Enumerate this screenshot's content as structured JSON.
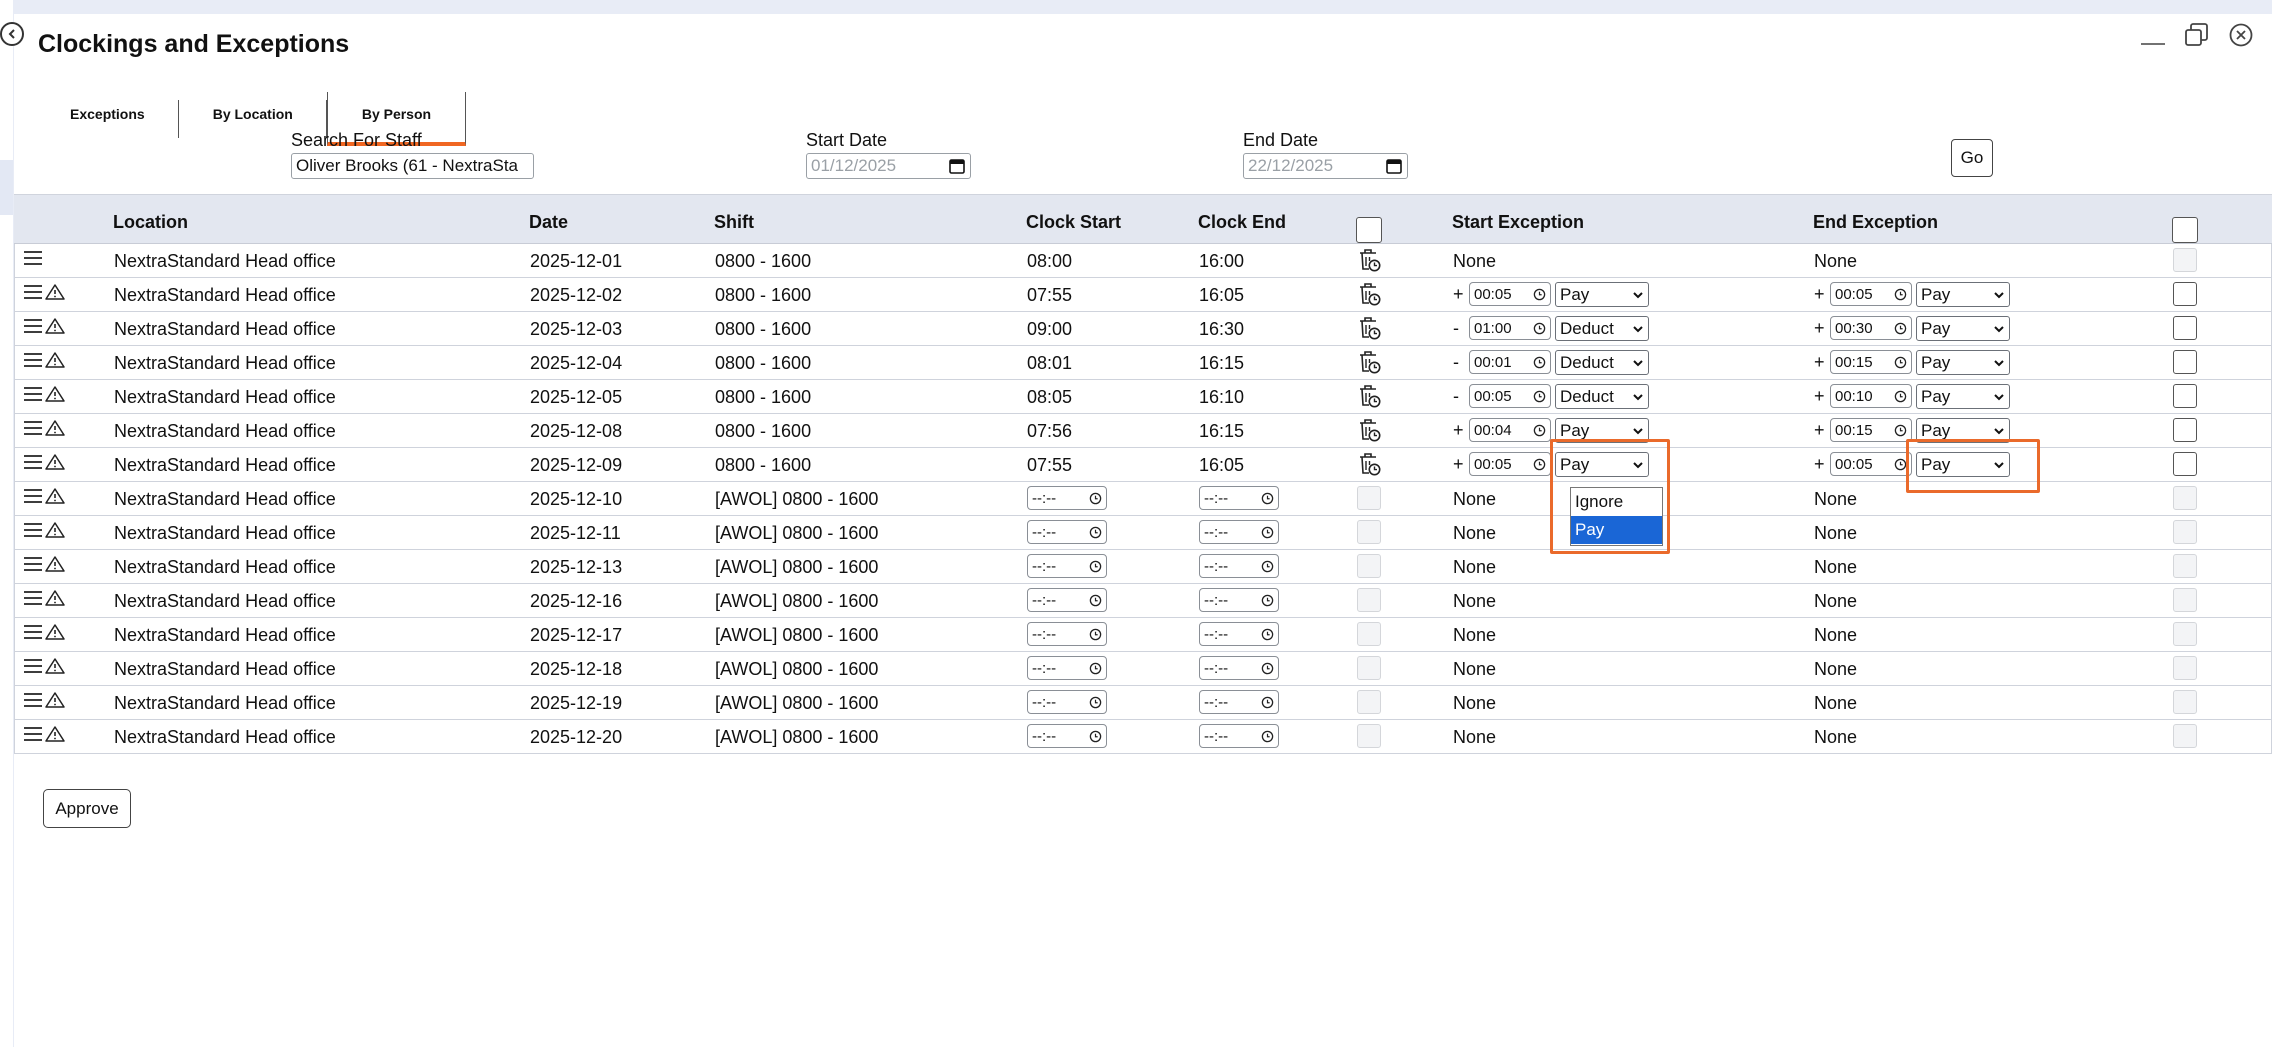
{
  "window": {
    "title": "Clockings and Exceptions"
  },
  "tabs": [
    {
      "label": "Exceptions",
      "active": false
    },
    {
      "label": "By Location",
      "active": false
    },
    {
      "label": "By Person",
      "active": true
    }
  ],
  "filters": {
    "search_label": "Search For Staff",
    "search_value": "Oliver Brooks (61 - NextraSta",
    "start_label": "Start Date",
    "start_value": "01/12/2025",
    "end_label": "End Date",
    "end_value": "22/12/2025",
    "go_label": "Go"
  },
  "columns": {
    "location": "Location",
    "date": "Date",
    "shift": "Shift",
    "clock_start": "Clock Start",
    "clock_end": "Clock End",
    "start_exception": "Start Exception",
    "end_exception": "End Exception"
  },
  "time_placeholder": "--:--",
  "rows": [
    {
      "warn": false,
      "location": "NextraStandard Head office",
      "date": "2025-12-01",
      "shift": "0800 - 1600",
      "clock_start": "08:00",
      "clock_end": "16:00",
      "start_exc": {
        "text": "None"
      },
      "end_exc": {
        "text": "None"
      }
    },
    {
      "warn": true,
      "location": "NextraStandard Head office",
      "date": "2025-12-02",
      "shift": "0800 - 1600",
      "clock_start": "07:55",
      "clock_end": "16:05",
      "start_exc": {
        "sign": "+",
        "time": "00:05",
        "action": "Pay"
      },
      "end_exc": {
        "sign": "+",
        "time": "00:05",
        "action": "Pay"
      }
    },
    {
      "warn": true,
      "location": "NextraStandard Head office",
      "date": "2025-12-03",
      "shift": "0800 - 1600",
      "clock_start": "09:00",
      "clock_end": "16:30",
      "start_exc": {
        "sign": "-",
        "time": "01:00",
        "action": "Deduct"
      },
      "end_exc": {
        "sign": "+",
        "time": "00:30",
        "action": "Pay"
      }
    },
    {
      "warn": true,
      "location": "NextraStandard Head office",
      "date": "2025-12-04",
      "shift": "0800 - 1600",
      "clock_start": "08:01",
      "clock_end": "16:15",
      "start_exc": {
        "sign": "-",
        "time": "00:01",
        "action": "Deduct"
      },
      "end_exc": {
        "sign": "+",
        "time": "00:15",
        "action": "Pay"
      }
    },
    {
      "warn": true,
      "location": "NextraStandard Head office",
      "date": "2025-12-05",
      "shift": "0800 - 1600",
      "clock_start": "08:05",
      "clock_end": "16:10",
      "start_exc": {
        "sign": "-",
        "time": "00:05",
        "action": "Deduct"
      },
      "end_exc": {
        "sign": "+",
        "time": "00:10",
        "action": "Pay"
      }
    },
    {
      "warn": true,
      "location": "NextraStandard Head office",
      "date": "2025-12-08",
      "shift": "0800 - 1600",
      "clock_start": "07:56",
      "clock_end": "16:15",
      "start_exc": {
        "sign": "+",
        "time": "00:04",
        "action": "Pay"
      },
      "end_exc": {
        "sign": "+",
        "time": "00:15",
        "action": "Pay"
      }
    },
    {
      "warn": true,
      "location": "NextraStandard Head office",
      "date": "2025-12-09",
      "shift": "0800 - 1600",
      "clock_start": "07:55",
      "clock_end": "16:05",
      "start_exc": {
        "sign": "+",
        "time": "00:05",
        "action": "Pay"
      },
      "end_exc": {
        "sign": "+",
        "time": "00:05",
        "action": "Pay"
      }
    },
    {
      "warn": true,
      "location": "NextraStandard Head office",
      "date": "2025-12-10",
      "shift": "[AWOL] 0800 - 1600",
      "awol": true,
      "start_exc": {
        "text": "None"
      },
      "end_exc": {
        "text": "None"
      }
    },
    {
      "warn": true,
      "location": "NextraStandard Head office",
      "date": "2025-12-11",
      "shift": "[AWOL] 0800 - 1600",
      "awol": true,
      "start_exc": {
        "text": "None"
      },
      "end_exc": {
        "text": "None"
      }
    },
    {
      "warn": true,
      "location": "NextraStandard Head office",
      "date": "2025-12-13",
      "shift": "[AWOL] 0800 - 1600",
      "awol": true,
      "start_exc": {
        "text": "None"
      },
      "end_exc": {
        "text": "None"
      }
    },
    {
      "warn": true,
      "location": "NextraStandard Head office",
      "date": "2025-12-16",
      "shift": "[AWOL] 0800 - 1600",
      "awol": true,
      "start_exc": {
        "text": "None"
      },
      "end_exc": {
        "text": "None"
      }
    },
    {
      "warn": true,
      "location": "NextraStandard Head office",
      "date": "2025-12-17",
      "shift": "[AWOL] 0800 - 1600",
      "awol": true,
      "start_exc": {
        "text": "None"
      },
      "end_exc": {
        "text": "None"
      }
    },
    {
      "warn": true,
      "location": "NextraStandard Head office",
      "date": "2025-12-18",
      "shift": "[AWOL] 0800 - 1600",
      "awol": true,
      "start_exc": {
        "text": "None"
      },
      "end_exc": {
        "text": "None"
      }
    },
    {
      "warn": true,
      "location": "NextraStandard Head office",
      "date": "2025-12-19",
      "shift": "[AWOL] 0800 - 1600",
      "awol": true,
      "start_exc": {
        "text": "None"
      },
      "end_exc": {
        "text": "None"
      }
    },
    {
      "warn": true,
      "location": "NextraStandard Head office",
      "date": "2025-12-20",
      "shift": "[AWOL] 0800 - 1600",
      "awol": true,
      "start_exc": {
        "text": "None"
      },
      "end_exc": {
        "text": "None"
      }
    }
  ],
  "dropdown": {
    "options": [
      "Ignore",
      "Pay"
    ],
    "selected": "Pay"
  },
  "approve_label": "Approve",
  "colors": {
    "accent": "#f06722",
    "highlight": "#ea6a2b",
    "selected_option": "#1a66d6",
    "header_bg": "#e3e7f0"
  },
  "icons": {
    "row_menu": "hamburger-menu-icon",
    "row_warning": "warning-triangle-icon",
    "row_delete": "trash-clock-icon",
    "time": "clock-icon",
    "dropdown": "chevron-down-icon",
    "date": "calendar-icon"
  }
}
